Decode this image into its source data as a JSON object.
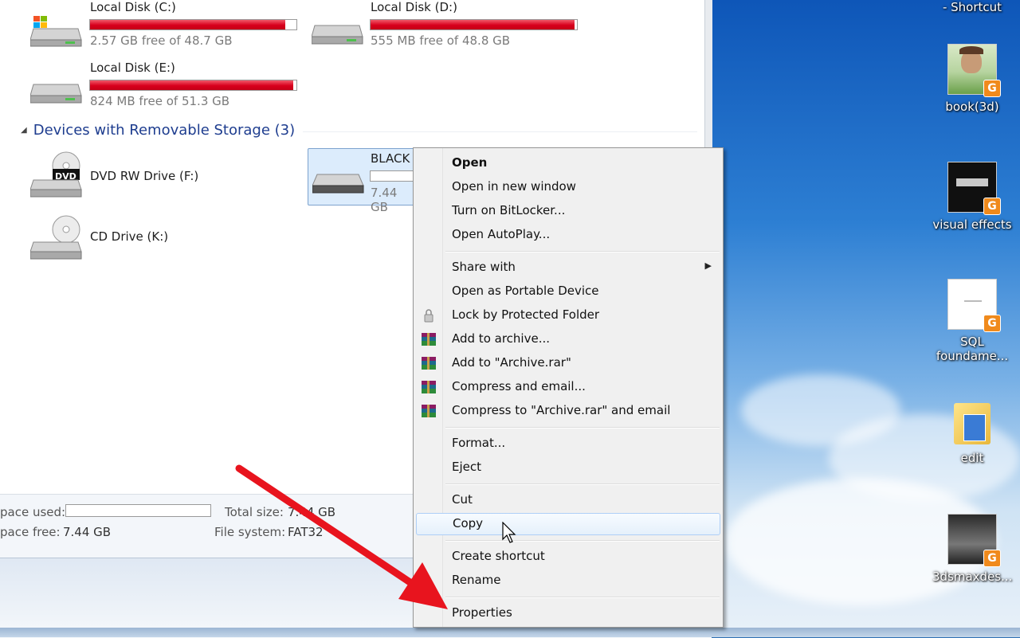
{
  "drives": {
    "c": {
      "name": "Local Disk (C:)",
      "free": "2.57 GB free of 48.7 GB",
      "used_fraction": 0.947
    },
    "d": {
      "name": "Local Disk (D:)",
      "free": "555 MB free of 48.8 GB",
      "used_fraction": 0.989
    },
    "e": {
      "name": "Local Disk (E:)",
      "free": "824 MB free of 51.3 GB",
      "used_fraction": 0.984
    }
  },
  "removable_group": {
    "title": "Devices with Removable Storage (3)"
  },
  "removable": {
    "dvd": {
      "name": "DVD RW Drive (F:)",
      "label": "DVD"
    },
    "cd": {
      "name": "CD Drive (K:)"
    },
    "usb": {
      "name": "BLACK",
      "free": "7.44 GB"
    }
  },
  "details": {
    "space_used_label": "pace used:",
    "space_free_label": "pace free:",
    "space_free_value": "7.44 GB",
    "total_size_label": "Total size:",
    "total_size_value": "7.44 GB",
    "file_system_label": "File system:",
    "file_system_value": "FAT32"
  },
  "context_menu": {
    "open": "Open",
    "open_new_window": "Open in new window",
    "bitlocker": "Turn on BitLocker...",
    "autoplay": "Open AutoPlay...",
    "share_with": "Share with",
    "portable": "Open as Portable Device",
    "lock": "Lock by Protected Folder",
    "add_archive": "Add to archive...",
    "add_archive_rar": "Add to \"Archive.rar\"",
    "compress_email": "Compress and email...",
    "compress_rar_email": "Compress to \"Archive.rar\" and email",
    "format": "Format...",
    "eject": "Eject",
    "cut": "Cut",
    "copy": "Copy",
    "create_shortcut": "Create shortcut",
    "rename": "Rename",
    "properties": "Properties"
  },
  "desktop_icons": {
    "shortcut": "- Shortcut",
    "book": "book(3d)",
    "visual": "visual effects",
    "sql": "SQL foundame...",
    "edit": "edit",
    "max": "3dsmaxdes..."
  },
  "colors": {
    "accent_red": "#d8001c",
    "highlight": "#dcecfc",
    "arrow": "#e8141e"
  }
}
